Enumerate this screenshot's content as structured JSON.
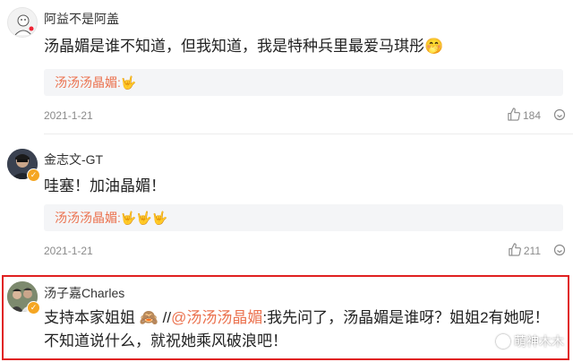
{
  "comments": [
    {
      "username": "阿益不是阿盖",
      "text": "汤晶媚是谁不知道，但我知道，我是特种兵里最爱马琪彤",
      "text_emoji": "🤭",
      "quote_user": "汤汤汤晶媚:",
      "quote_emoji": "🤟",
      "date": "2021-1-21",
      "likes": "184"
    },
    {
      "username": "金志文-GT",
      "text": "哇塞！加油晶媚！",
      "quote_user": "汤汤汤晶媚:",
      "quote_emoji": "🤟🤟🤟",
      "date": "2021-1-21",
      "likes": "211"
    },
    {
      "username": "汤子嘉Charles",
      "text_line1_a": "支持本家姐姐",
      "text_line1_emoji": "🙈",
      "text_line1_sep": " //",
      "text_line1_mention": "@汤汤汤晶媚",
      "text_line1_b": ":我先问了，汤晶媚是谁呀？姐姐2有她呢！",
      "text_line2": "不知道说什么，就祝她乘风破浪吧！"
    }
  ],
  "watermark": "萌神木木",
  "colors": {
    "accent": "#eb7350",
    "highlight": "#e02020",
    "badge": "#f5a623"
  },
  "icons": [
    "like-icon",
    "more-icon",
    "verified-badge-icon"
  ]
}
